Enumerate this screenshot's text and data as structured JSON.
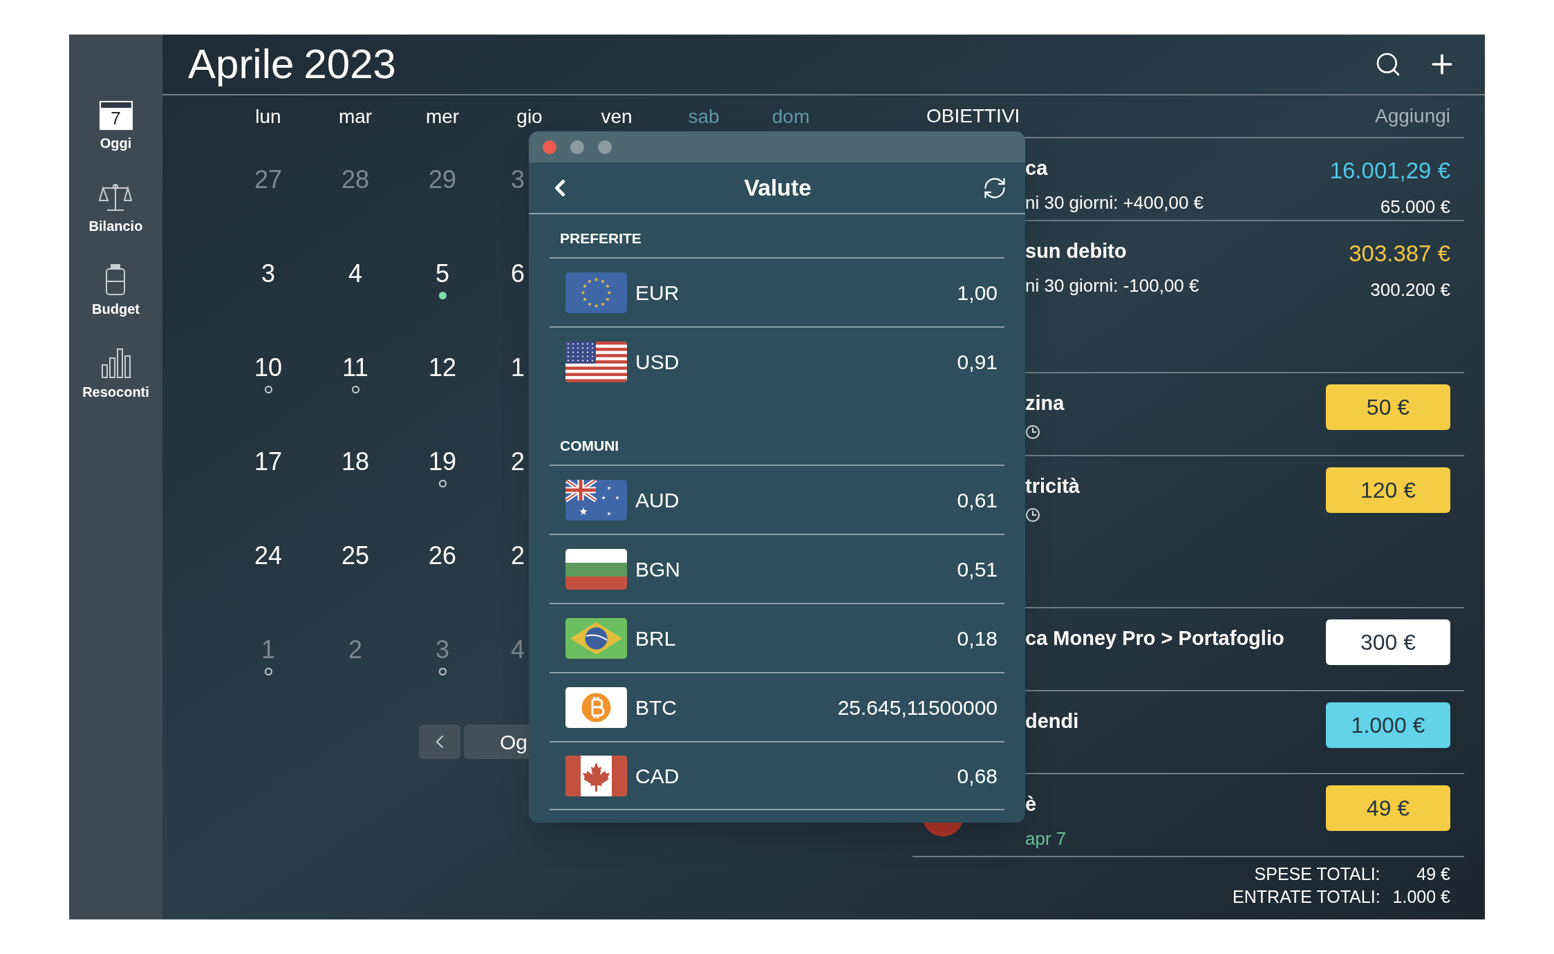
{
  "sidebar": {
    "items": [
      {
        "label": "Oggi",
        "icon_text": "7"
      },
      {
        "label": "Bilancio"
      },
      {
        "label": "Budget"
      },
      {
        "label": "Resoconti"
      }
    ]
  },
  "header": {
    "month": "Aprile",
    "year": "2023"
  },
  "calendar": {
    "weekdays": [
      {
        "label": "lun",
        "weekend": false
      },
      {
        "label": "mar",
        "weekend": false
      },
      {
        "label": "mer",
        "weekend": false
      },
      {
        "label": "gio",
        "weekend": false
      },
      {
        "label": "ven",
        "weekend": false
      },
      {
        "label": "sab",
        "weekend": true
      },
      {
        "label": "dom",
        "weekend": true
      }
    ],
    "weeks": [
      [
        {
          "day": "27",
          "muted": true
        },
        {
          "day": "28",
          "muted": true
        },
        {
          "day": "29",
          "muted": true
        },
        {
          "day": "3",
          "muted": true
        }
      ],
      [
        {
          "day": "3",
          "muted": false
        },
        {
          "day": "4",
          "muted": false
        },
        {
          "day": "5",
          "muted": false,
          "event": {
            "kind": "filled"
          }
        },
        {
          "day": "6",
          "muted": false
        }
      ],
      [
        {
          "day": "10",
          "muted": false,
          "event": {
            "kind": "hollow"
          }
        },
        {
          "day": "11",
          "muted": false,
          "event": {
            "kind": "hollow"
          }
        },
        {
          "day": "12",
          "muted": false
        },
        {
          "day": "1",
          "muted": false
        }
      ],
      [
        {
          "day": "17",
          "muted": false
        },
        {
          "day": "18",
          "muted": false
        },
        {
          "day": "19",
          "muted": false,
          "event": {
            "kind": "hollow"
          }
        },
        {
          "day": "2",
          "muted": false
        }
      ],
      [
        {
          "day": "24",
          "muted": false
        },
        {
          "day": "25",
          "muted": false
        },
        {
          "day": "26",
          "muted": false
        },
        {
          "day": "2",
          "muted": false
        }
      ],
      [
        {
          "day": "1",
          "muted": true,
          "event": {
            "kind": "hollow"
          }
        },
        {
          "day": "2",
          "muted": true
        },
        {
          "day": "3",
          "muted": true,
          "event": {
            "kind": "hollow"
          }
        },
        {
          "day": "4",
          "muted": true
        }
      ]
    ],
    "today_button": "Og"
  },
  "goals": {
    "title": "OBIETTIVI",
    "add": "Aggiungi",
    "items": [
      {
        "name": "ca",
        "note": "ni 30 giorni: +400,00 €",
        "amount": "16.001,29 €",
        "target": "65.000 €",
        "color": "#4fc8e8"
      },
      {
        "name": "sun debito",
        "note": "ni 30 giorni: -100,00 €",
        "amount": "303.387 €",
        "target": "300.200 €",
        "color": "#f3c744"
      }
    ]
  },
  "transactions": {
    "items": [
      {
        "name": "zina",
        "scheduled": true,
        "amount": "50 €",
        "color": "#f5cd45"
      },
      {
        "name": "tricità",
        "scheduled": true,
        "amount": "120 €",
        "color": "#f5cd45"
      },
      {
        "name": "ca Money Pro > Portafoglio",
        "scheduled": false,
        "amount": "300 €",
        "color": "#ffffff"
      },
      {
        "name": "dendi",
        "scheduled": false,
        "amount": "1.000 €",
        "color": "#62d3e9"
      },
      {
        "name": "è",
        "scheduled": false,
        "date": "apr 7",
        "amount": "49 €",
        "color": "#f5cd45"
      }
    ]
  },
  "totals": [
    {
      "label": "SPESE TOTALI:",
      "value": "49 €"
    },
    {
      "label": "ENTRATE TOTALI:",
      "value": "1.000 €"
    }
  ],
  "currency_dialog": {
    "title": "Valute",
    "sections": [
      {
        "title": "PREFERITE",
        "rows": [
          {
            "code": "EUR",
            "rate": "1,00"
          },
          {
            "code": "USD",
            "rate": "0,91"
          }
        ]
      },
      {
        "title": "COMUNI",
        "rows": [
          {
            "code": "AUD",
            "rate": "0,61"
          },
          {
            "code": "BGN",
            "rate": "0,51"
          },
          {
            "code": "BRL",
            "rate": "0,18"
          },
          {
            "code": "BTC",
            "rate": "25.645,11500000"
          },
          {
            "code": "CAD",
            "rate": "0,68"
          }
        ]
      }
    ]
  }
}
